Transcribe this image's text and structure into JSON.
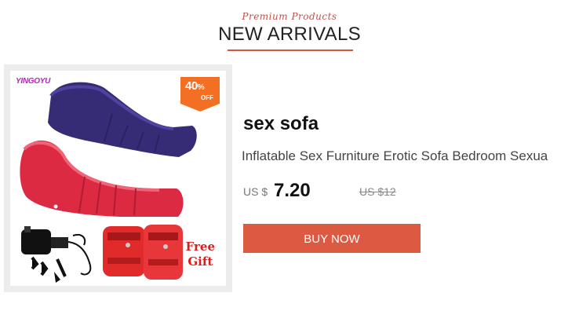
{
  "header": {
    "script": "Premium Products",
    "title": "NEW ARRIVALS"
  },
  "product": {
    "brand_logo": "YINGOYU",
    "badge_percent": "40",
    "badge_symbol": "%",
    "badge_off": "OFF",
    "free_gift_line1": "Free",
    "free_gift_line2": "Gift",
    "name": "sex sofa",
    "description": "Inflatable Sex Furniture Erotic Sofa Bedroom Sexua",
    "currency": "US $",
    "price": "7.20",
    "old_price": "US $12",
    "buy_label": "BUY NOW"
  },
  "colors": {
    "accent": "#dc5a42",
    "badge": "#f36f23",
    "sofa_blue": "#3a2f7a",
    "sofa_red": "#d9253d",
    "cuff_red": "#e12a2a"
  }
}
